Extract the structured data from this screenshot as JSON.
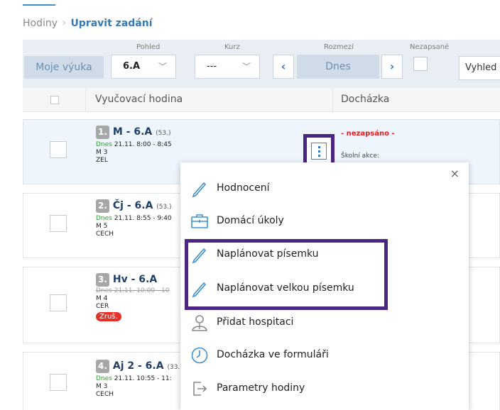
{
  "breadcrumb": {
    "parent": "Hodiny",
    "separator": "›",
    "current": "Upravit zadání"
  },
  "filters": {
    "my_teaching": "Moje výuka",
    "view_label": "Pohled",
    "view_value": "6.A",
    "course_label": "Kurz",
    "course_value": "---",
    "range_label": "Rozmezí",
    "range_value": "Dnes",
    "unrecorded_label": "Nezapsané",
    "search_text": "Vyhled"
  },
  "table": {
    "col_lesson": "Vyučovací hodina",
    "col_attendance": "Docházka"
  },
  "lessons": [
    {
      "num": "1.",
      "subject": "M - 6.A",
      "count": "(53.)",
      "today": "Dnes",
      "date": "21.11.",
      "time": "8:00 - 8:45",
      "room": "M 3",
      "teacher": "ZEL"
    },
    {
      "num": "2.",
      "subject": "Čj - 6.A",
      "count": "(53.)",
      "today": "Dnes",
      "date": "21.11.",
      "time": "8:55 - 9:40",
      "room": "M 5",
      "teacher": "CECH"
    },
    {
      "num": "3.",
      "subject": "Hv - 6.A",
      "struck": "Dnes 21.11. 10:00 - 10",
      "room": "M 4",
      "teacher": "CER",
      "badge": "Zruš."
    },
    {
      "num": "4.",
      "subject": "Aj 2 - 6.A",
      "count": "(33.",
      "today": "Dnes",
      "date": "21.11.",
      "time": "10:55 - 11:",
      "room": "M 3",
      "teacher": "CECH"
    }
  ],
  "attendance": {
    "status": "- nezapsáno -",
    "school_event": "Školní akce:"
  },
  "menu": {
    "close": "×",
    "items": [
      {
        "label": "Hodnocení",
        "icon": "pencil-icon"
      },
      {
        "label": "Domácí úkoly",
        "icon": "briefcase-icon"
      },
      {
        "label": "Naplánovat písemku",
        "icon": "pencil-icon"
      },
      {
        "label": "Naplánovat velkou písemku",
        "icon": "pencil-icon"
      },
      {
        "label": "Přidat hospitaci",
        "icon": "person-icon"
      },
      {
        "label": "Docházka ve formuláři",
        "icon": "clock-icon"
      },
      {
        "label": "Parametry hodiny",
        "icon": "arrow-out-icon"
      }
    ]
  },
  "colors": {
    "accent": "#3579b8",
    "highlight": "#4b2680",
    "today": "#2aa62a",
    "alert": "#e53127"
  }
}
